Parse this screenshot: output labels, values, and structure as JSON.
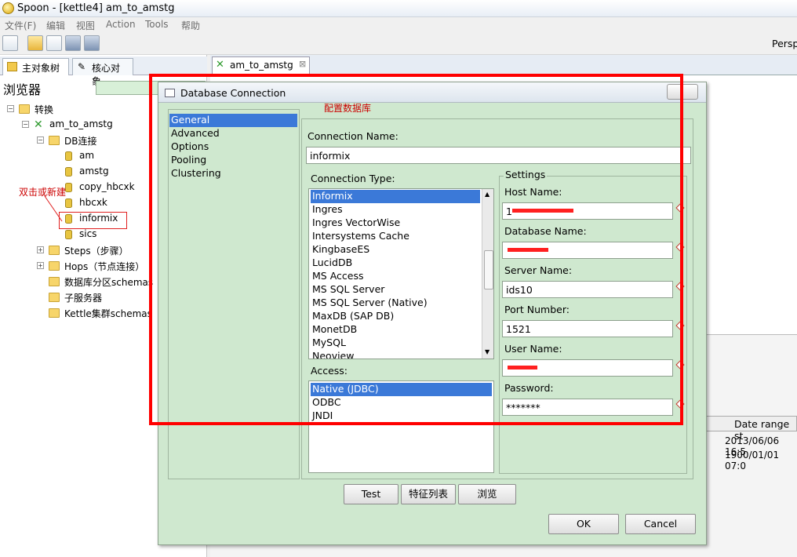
{
  "window": {
    "title": "Spoon - [kettle4] am_to_amstg"
  },
  "menu": [
    "文件(F)",
    "编辑",
    "视图",
    "Action",
    "Tools",
    "帮助"
  ],
  "perspective": {
    "label": "Persp"
  },
  "left_tabs": [
    {
      "label": "主对象树"
    },
    {
      "label": "核心对象"
    }
  ],
  "browser": {
    "label": "浏览器"
  },
  "tree": [
    {
      "label": "转换"
    },
    {
      "label": "am_to_amstg"
    },
    {
      "label": "DB连接"
    },
    {
      "label": "am"
    },
    {
      "label": "amstg"
    },
    {
      "label": "copy_hbcxk"
    },
    {
      "label": "hbcxk"
    },
    {
      "label": "informix"
    },
    {
      "label": "sics"
    },
    {
      "label": "Steps（步骤）"
    },
    {
      "label": "Hops（节点连接）"
    },
    {
      "label": "数据库分区schemas"
    },
    {
      "label": "子服务器"
    },
    {
      "label": "Kettle集群schemas"
    }
  ],
  "annotation": {
    "label": "双击或新建"
  },
  "editor_tab": {
    "label": "am_to_amstg"
  },
  "background_table": {
    "header": "Date range st",
    "rows": [
      "2013/06/06 16:5",
      "1900/01/01 07:0"
    ]
  },
  "dialog": {
    "title": "Database Connection",
    "nav": [
      "General",
      "Advanced",
      "Options",
      "Pooling",
      "Clustering"
    ],
    "note": "配置数据库",
    "connection_name_label": "Connection Name:",
    "connection_name": "informix",
    "connection_type_label": "Connection Type:",
    "connection_types": [
      "Informix",
      "Ingres",
      "Ingres VectorWise",
      "Intersystems Cache",
      "KingbaseES",
      "LucidDB",
      "MS Access",
      "MS SQL Server",
      "MS SQL Server (Native)",
      "MaxDB (SAP DB)",
      "MonetDB",
      "MySQL",
      "Neoview"
    ],
    "access_label": "Access:",
    "access_types": [
      "Native (JDBC)",
      "ODBC",
      "JNDI"
    ],
    "settings": {
      "legend": "Settings",
      "host_label": "Host Name:",
      "host_value": "1",
      "db_label": "Database Name:",
      "db_value": "",
      "server_label": "Server Name:",
      "server_value": "ids10",
      "port_label": "Port Number:",
      "port_value": "1521",
      "user_label": "User Name:",
      "user_value": "",
      "password_label": "Password:",
      "password_value": "*******"
    },
    "buttons": {
      "test": "Test",
      "features": "特征列表",
      "explore": "浏览",
      "ok": "OK",
      "cancel": "Cancel"
    }
  },
  "colors": {
    "highlight": "#ff0000",
    "dialog_bg": "#cfe8cf",
    "selection": "#3b79d8",
    "annotation_text": "#cc0000"
  }
}
